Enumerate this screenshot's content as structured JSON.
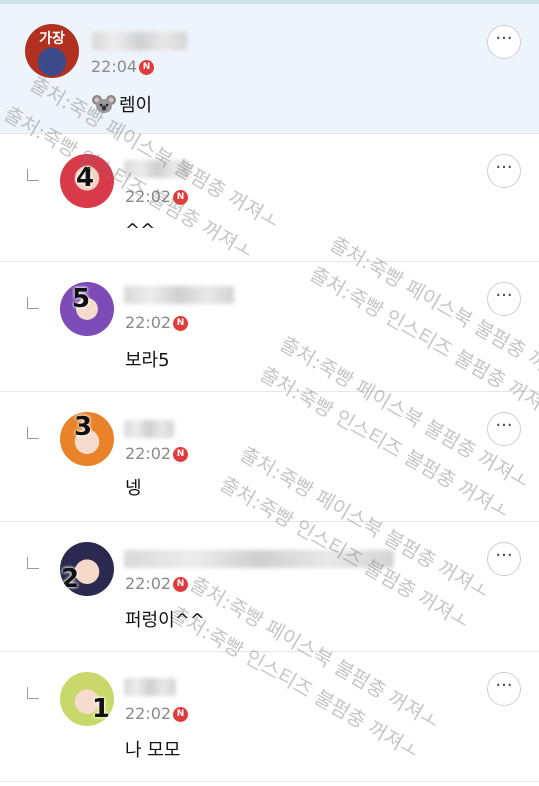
{
  "comments": [
    {
      "avatar_label": "가장",
      "time": "22:04",
      "new_badge": "N",
      "text": "렘이",
      "emoji_icon": "koala-icon",
      "is_reply": false
    },
    {
      "avatar_label": "4",
      "time": "22:02",
      "new_badge": "N",
      "text": "^^",
      "is_reply": true
    },
    {
      "avatar_label": "5",
      "time": "22:02",
      "new_badge": "N",
      "text": "보라5",
      "is_reply": true
    },
    {
      "avatar_label": "3",
      "time": "22:02",
      "new_badge": "N",
      "text": "넹",
      "is_reply": true
    },
    {
      "avatar_label": "2",
      "time": "22:02",
      "new_badge": "N",
      "text": "퍼렁이^^",
      "is_reply": true
    },
    {
      "avatar_label": "1",
      "time": "22:02",
      "new_badge": "N",
      "text": "나 모모",
      "is_reply": true
    }
  ],
  "more_button_label": "···",
  "watermark": {
    "line1": "출처:죽빵 페이스북 불펌충 꺼져ㅗ",
    "line2": "출처:죽빵 인스티즈 불펌충 꺼져ㅗ"
  },
  "colors": {
    "highlight_bg": "#eef4fb",
    "new_badge": "#e23b3b",
    "time_text": "#8a8a8a"
  }
}
